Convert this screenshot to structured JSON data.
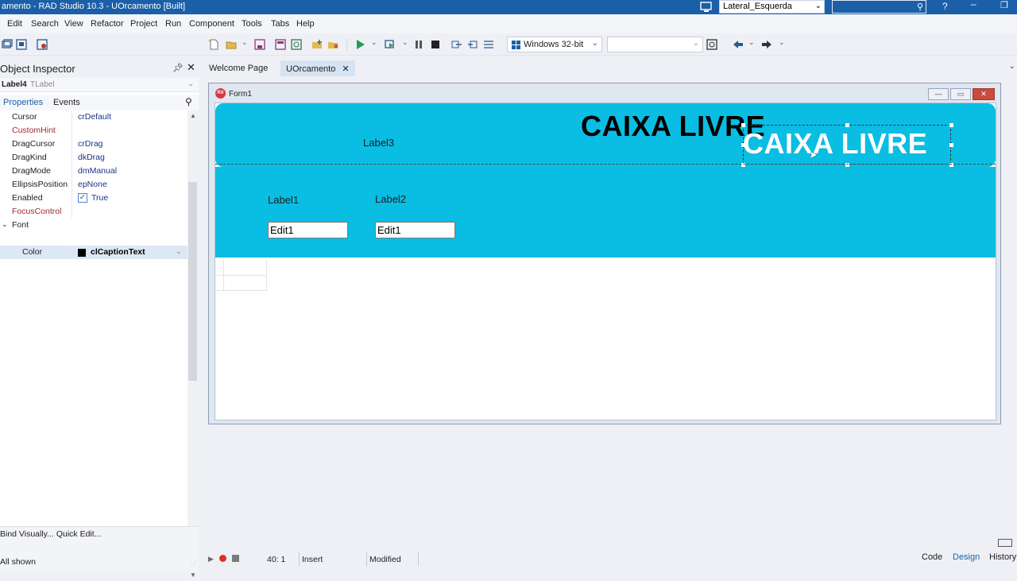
{
  "titlebar": {
    "title": "amento - RAD Studio 10.3 - UOrcamento [Built]",
    "layout_value": "Lateral_Esquerda",
    "help": "?",
    "minimize": "–",
    "maximize": "❐"
  },
  "menu": [
    "Edit",
    "Search",
    "View",
    "Refactor",
    "Project",
    "Run",
    "Component",
    "Tools",
    "Tabs",
    "Help"
  ],
  "toolbar": {
    "platform": "Windows 32-bit",
    "configuration": ""
  },
  "object_inspector": {
    "title": "Object Inspector",
    "object_name": "Label4",
    "object_type": "TLabel",
    "tabs": [
      "Properties",
      "Events"
    ],
    "properties": [
      {
        "name": "Cursor",
        "value": "crDefault",
        "red": false
      },
      {
        "name": "CustomHint",
        "value": "",
        "red": true
      },
      {
        "name": "DragCursor",
        "value": "crDrag",
        "red": false
      },
      {
        "name": "DragKind",
        "value": "dkDrag",
        "red": false
      },
      {
        "name": "DragMode",
        "value": "dmManual",
        "red": false
      },
      {
        "name": "EllipsisPosition",
        "value": "epNone",
        "red": false
      },
      {
        "name": "Enabled",
        "value": "True",
        "red": false
      },
      {
        "name": "FocusControl",
        "value": "",
        "red": true
      },
      {
        "name": "Font",
        "value": "",
        "red": false
      },
      {
        "name": "Color",
        "value": "clCaptionText",
        "red": false
      }
    ],
    "bind_links": "Bind Visually...  Quick Edit...",
    "all_shown": "All shown"
  },
  "editor": {
    "tabs": [
      "Welcome Page",
      "UOrcamento"
    ],
    "active_tab": "UOrcamento"
  },
  "form": {
    "caption": "Form1",
    "app_icon_text": "RX",
    "label3": "Label3",
    "caixa_black": "CAIXA LIVRE",
    "caixa_white": "CAIXA LIVRE",
    "label1": "Label1",
    "label2": "Label2",
    "edit1a": "Edit1",
    "edit1b": "Edit1"
  },
  "statusbar": {
    "position": "40:  1",
    "mode": "Insert",
    "modified": "Modified",
    "tabs": [
      "Code",
      "Design",
      "History"
    ],
    "active": "Design"
  },
  "colors": {
    "titlebar": "#1b5fa8",
    "panel_cyan": "#0abde3",
    "accent_blue": "#1b5fa8",
    "close_red": "#c94b3b"
  }
}
